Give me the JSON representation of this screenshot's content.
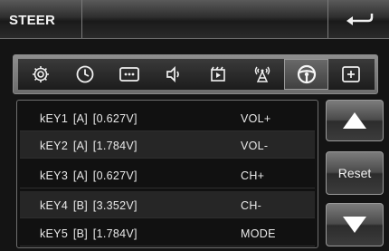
{
  "header": {
    "title": "STEER",
    "back_icon": "back-arrow-icon"
  },
  "toolbar": {
    "items": [
      {
        "icon": "gear-icon",
        "active": false
      },
      {
        "icon": "clock-icon",
        "active": false
      },
      {
        "icon": "keypad-icon",
        "active": false
      },
      {
        "icon": "speaker-icon",
        "active": false
      },
      {
        "icon": "media-icon",
        "active": false
      },
      {
        "icon": "antenna-icon",
        "active": false
      },
      {
        "icon": "steering-wheel-icon",
        "active": true
      },
      {
        "icon": "plus-box-icon",
        "active": false
      }
    ]
  },
  "keys": [
    {
      "key": "kEY1  [A]  [0.627V]",
      "function": "VOL+"
    },
    {
      "key": "kEY2  [A]  [1.784V]",
      "function": "VOL-"
    },
    {
      "key": "kEY3  [A]  [0.627V]",
      "function": "CH+"
    },
    {
      "key": "kEY4  [B]  [3.352V]",
      "function": "CH-"
    },
    {
      "key": "kEY5  [B]  [1.784V]",
      "function": "MODE"
    }
  ],
  "buttons": {
    "up_icon": "triangle-up-icon",
    "reset_label": "Reset",
    "down_icon": "triangle-down-icon"
  },
  "colors": {
    "background": "#141414",
    "active_tab": "#5a5a5a",
    "text": "#e8e8e8"
  }
}
